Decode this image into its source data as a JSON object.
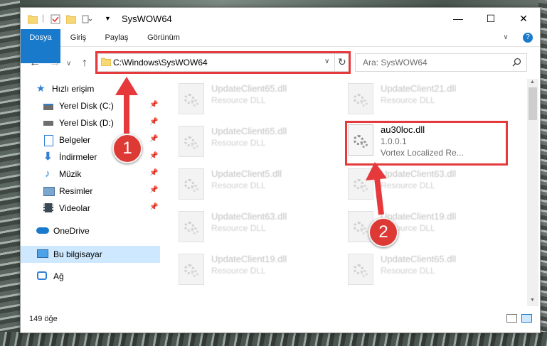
{
  "window": {
    "title": "SysWOW64",
    "minimize": "—",
    "maximize": "☐",
    "close": "✕"
  },
  "ribbon": {
    "tabs": [
      "Dosya",
      "Giriş",
      "Paylaş",
      "Görünüm"
    ],
    "help": "?"
  },
  "nav": {
    "back": "←",
    "forward": "→",
    "dropdown": "∨",
    "up": "↑"
  },
  "address": {
    "path": "C:\\Windows\\SysWOW64",
    "dropdown": "∨",
    "refresh": "↻"
  },
  "search": {
    "placeholder": "Ara: SysWOW64"
  },
  "sidebar": {
    "items": [
      {
        "label": "Hızlı erişim",
        "icon": "star-icon"
      },
      {
        "label": "Yerel Disk (C:)",
        "icon": "drive-icon",
        "pinned": true
      },
      {
        "label": "Yerel Disk (D:)",
        "icon": "drive-icon",
        "pinned": true
      },
      {
        "label": "Belgeler",
        "icon": "documents-icon",
        "pinned": true
      },
      {
        "label": "İndirmeler",
        "icon": "download-icon",
        "pinned": true
      },
      {
        "label": "Müzik",
        "icon": "music-icon",
        "pinned": true
      },
      {
        "label": "Resimler",
        "icon": "pictures-icon",
        "pinned": true
      },
      {
        "label": "Videolar",
        "icon": "video-icon",
        "pinned": true
      },
      {
        "label": "OneDrive",
        "icon": "cloud-icon"
      },
      {
        "label": "Bu bilgisayar",
        "icon": "computer-icon",
        "selected": true
      },
      {
        "label": "Ağ",
        "icon": "network-icon"
      }
    ]
  },
  "files": [
    {
      "name": "UpdateClient65.dll",
      "type": "Resource DLL"
    },
    {
      "name": "UpdateClient21.dll",
      "type": "Resource DLL"
    },
    {
      "name": "UpdateClient65.dll",
      "type": "Resource DLL"
    },
    {
      "name": "au30loc.dll",
      "version": "1.0.0.1",
      "type": "Vortex Localized Re...",
      "highlighted": true
    },
    {
      "name": "UpdateClient5.dll",
      "type": "Resource DLL"
    },
    {
      "name": "UpdateClient63.dll",
      "type": "Resource DLL"
    },
    {
      "name": "UpdateClient63.dll",
      "type": "Resource DLL"
    },
    {
      "name": "UpdateClient19.dll",
      "type": "Resource DLL"
    },
    {
      "name": "UpdateClient19.dll",
      "type": "Resource DLL"
    },
    {
      "name": "UpdateClient65.dll",
      "type": "Resource DLL"
    }
  ],
  "status": {
    "count": "149 öğe"
  },
  "annotations": {
    "badge1": "1",
    "badge2": "2",
    "color": "#e5393c"
  }
}
